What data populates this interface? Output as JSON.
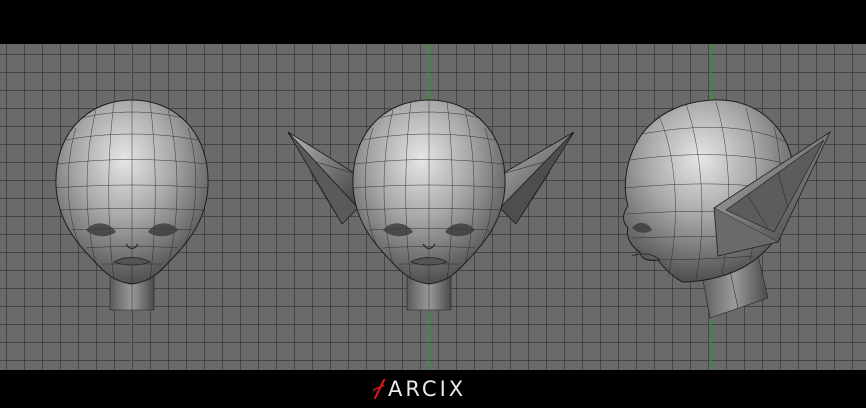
{
  "viewport": {
    "background_color": "#6a6a6a",
    "grid_color": "#2a2a2a",
    "axis_color": "#3e8a3e",
    "views": [
      {
        "name": "front-view",
        "ears": false
      },
      {
        "name": "front-view-with-ears",
        "ears": true
      },
      {
        "name": "side-view",
        "ears": true
      }
    ]
  },
  "branding": {
    "logo_text": "ARCIX",
    "logo_mark_color": "#d11a1a",
    "logo_mark_icon": "slash-s-mark"
  }
}
